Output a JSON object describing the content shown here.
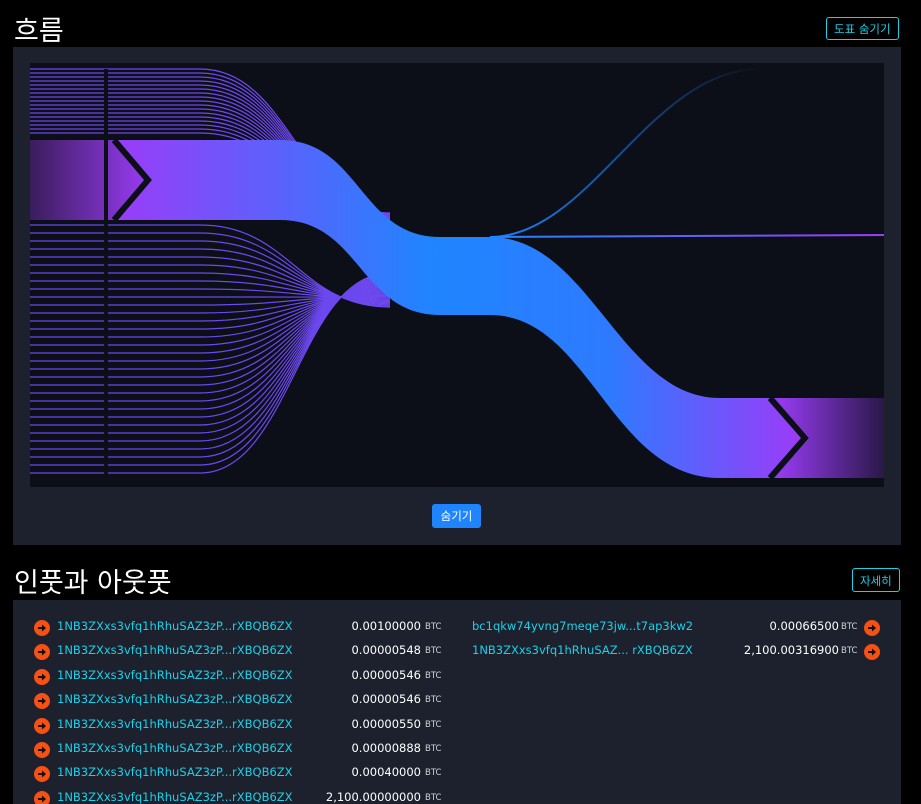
{
  "flow_section": {
    "title": "흐름",
    "hide_chart_label": "도표 숨기기",
    "hide_label": "숨기기"
  },
  "io_section": {
    "title": "인풋과 아웃풋",
    "details_label": "자세히",
    "inputs": [
      {
        "address": "1NB3ZXxs3vfq1hRhuSAZ3zP...rXBQB6ZX",
        "amount": "0.00100000",
        "unit": "BTC"
      },
      {
        "address": "1NB3ZXxs3vfq1hRhuSAZ3zP...rXBQB6ZX",
        "amount": "0.00000548",
        "unit": "BTC"
      },
      {
        "address": "1NB3ZXxs3vfq1hRhuSAZ3zP...rXBQB6ZX",
        "amount": "0.00000546",
        "unit": "BTC"
      },
      {
        "address": "1NB3ZXxs3vfq1hRhuSAZ3zP...rXBQB6ZX",
        "amount": "0.00000546",
        "unit": "BTC"
      },
      {
        "address": "1NB3ZXxs3vfq1hRhuSAZ3zP...rXBQB6ZX",
        "amount": "0.00000550",
        "unit": "BTC"
      },
      {
        "address": "1NB3ZXxs3vfq1hRhuSAZ3zP...rXBQB6ZX",
        "amount": "0.00000888",
        "unit": "BTC"
      },
      {
        "address": "1NB3ZXxs3vfq1hRhuSAZ3zP...rXBQB6ZX",
        "amount": "0.00040000",
        "unit": "BTC"
      },
      {
        "address": "1NB3ZXxs3vfq1hRhuSAZ3zP...rXBQB6ZX",
        "amount": "2,100.00000000",
        "unit": "BTC"
      }
    ],
    "outputs": [
      {
        "address": "bc1qkw74yvng7meqe73jw...t7ap3kw2",
        "amount": "0.00066500",
        "unit": "BTC"
      },
      {
        "address": "1NB3ZXxs3vfq1hRhuSAZ...  rXBQB6ZX",
        "amount": "2,100.00316900",
        "unit": "BTC"
      }
    ]
  },
  "colors": {
    "accent": "#1bd1e8",
    "button_blue": "#1f85ff",
    "arrow_orange": "#f84f13",
    "flow_purple": "#9b3cf8",
    "flow_blue": "#1f85ff",
    "panel_bg": "#1c212d",
    "chart_bg": "#0c0f17"
  },
  "icons": {
    "input_arrow": "arrow-right-circle-icon",
    "output_arrow": "arrow-right-circle-icon"
  }
}
